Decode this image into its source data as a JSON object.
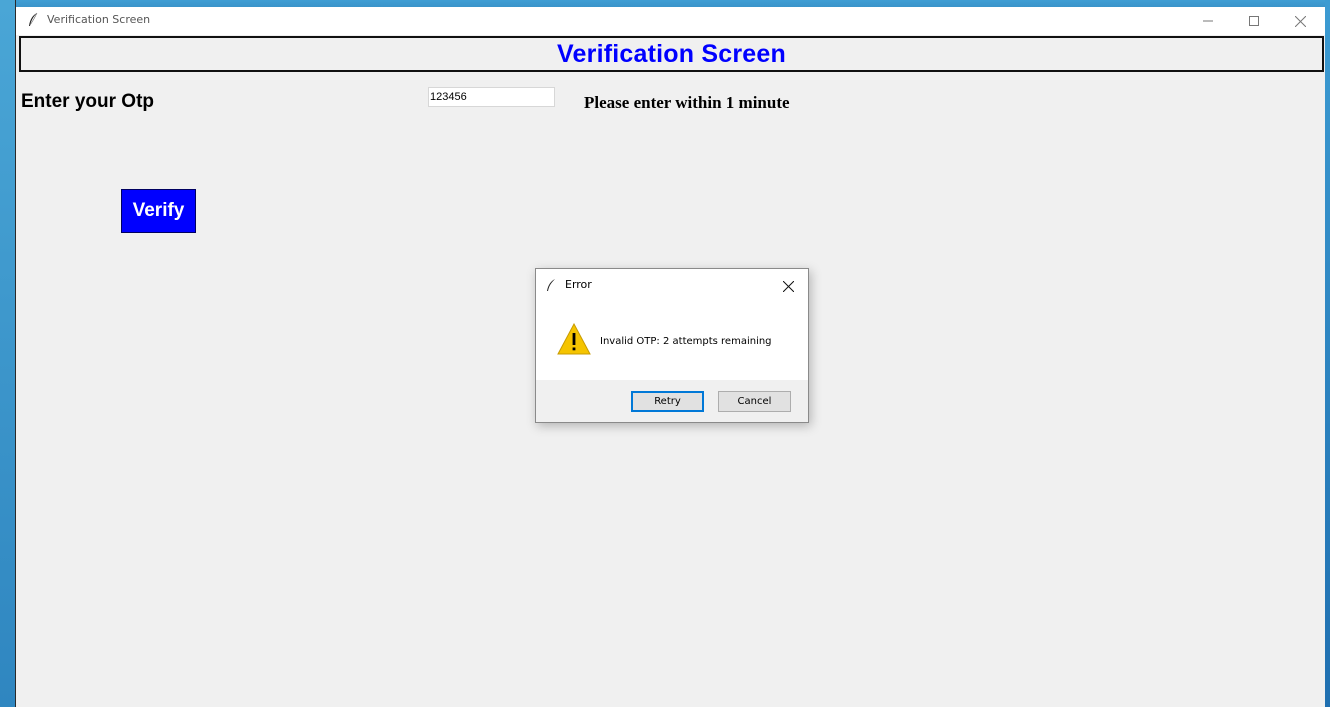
{
  "window": {
    "title": "Verification Screen",
    "controls": {
      "minimize_icon": "minimize-icon",
      "maximize_icon": "maximize-icon",
      "close_icon": "close-icon"
    }
  },
  "header": {
    "text": "Verification Screen",
    "color": "#0000ff"
  },
  "form": {
    "otp_label": "Enter your Otp",
    "otp_value": "123456",
    "hint": "Please enter within 1 minute",
    "verify_label": "Verify",
    "verify_color": "#0000ff"
  },
  "dialog": {
    "title": "Error",
    "message": "Invalid OTP: 2 attempts remaining",
    "icon": "warning-icon",
    "buttons": {
      "retry": "Retry",
      "cancel": "Cancel"
    }
  }
}
